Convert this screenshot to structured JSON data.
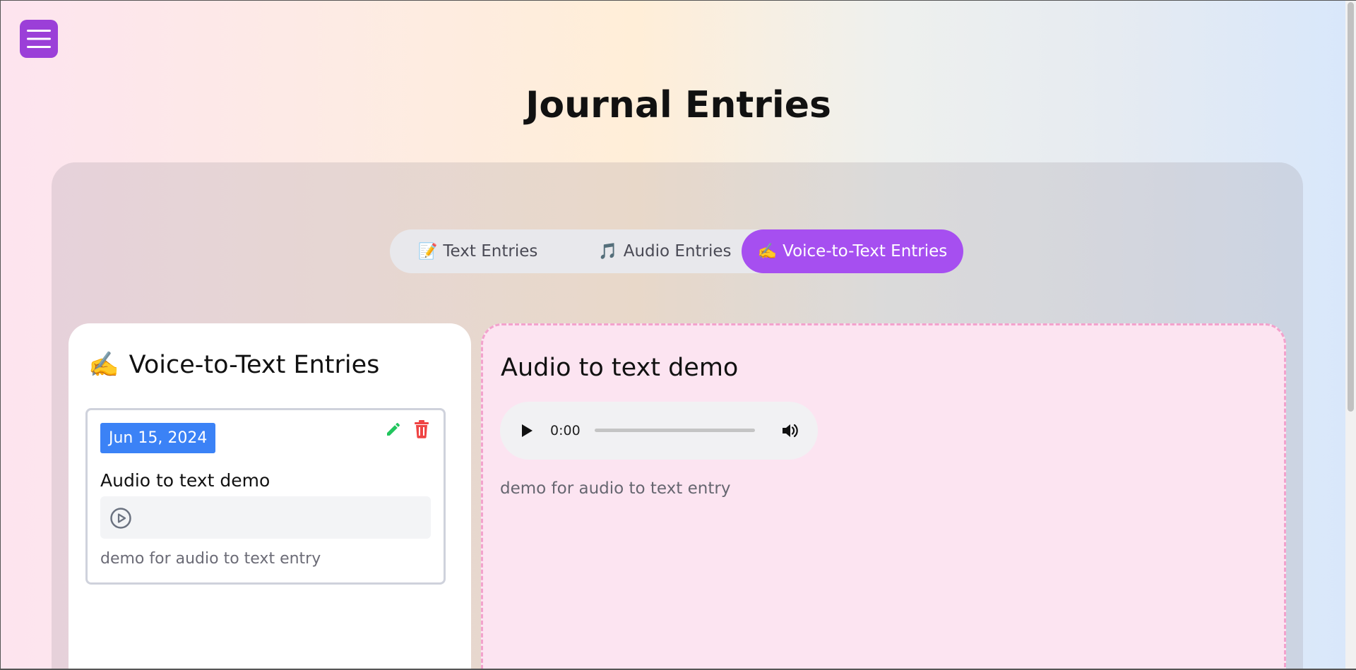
{
  "page": {
    "title": "Journal Entries"
  },
  "menu": {
    "icon": "hamburger-menu-icon",
    "color": "#9b3fd8"
  },
  "tabs": [
    {
      "emoji": "📝",
      "label": "Text Entries",
      "active": false
    },
    {
      "emoji": "🎵",
      "label": "Audio Entries",
      "active": false
    },
    {
      "emoji": "✍️",
      "label": "Voice-to-Text Entries",
      "active": true
    }
  ],
  "list": {
    "emoji": "✍️",
    "title": "Voice-to-Text Entries",
    "entries": [
      {
        "date": "Jun 15, 2024",
        "title": "Audio to text demo",
        "description": "demo for audio to text entry",
        "edit_icon": "pencil-icon",
        "delete_icon": "trash-icon",
        "play_icon": "play-circle-icon"
      }
    ]
  },
  "detail": {
    "title": "Audio to text demo",
    "player": {
      "time": "0:00",
      "play_icon": "play-icon",
      "volume_icon": "volume-icon"
    },
    "description": "demo for audio to text entry"
  },
  "colors": {
    "accent": "#a64ff0",
    "date_badge": "#3b82f6",
    "edit": "#22c55e",
    "delete": "#ef4444",
    "detail_bg": "#fce4f1"
  }
}
